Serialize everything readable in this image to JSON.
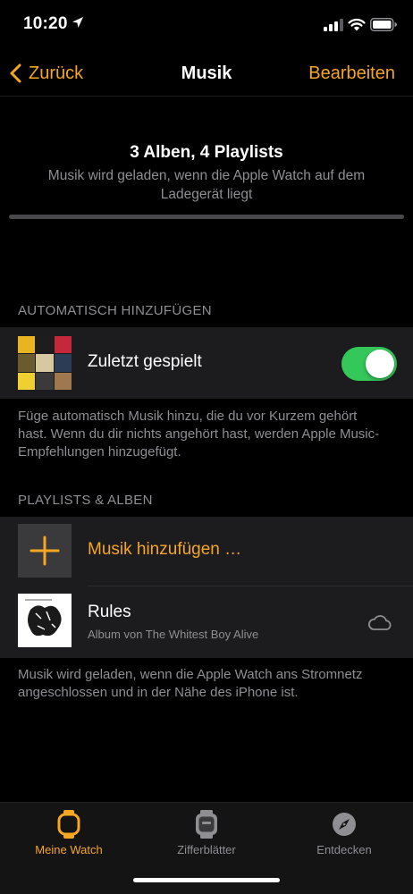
{
  "status": {
    "time": "10:20"
  },
  "nav": {
    "back_label": "Zurück",
    "title": "Musik",
    "edit_label": "Bearbeiten"
  },
  "sync": {
    "title": "3 Alben, 4 Playlists",
    "subtitle": "Musik wird geladen, wenn die Apple Watch auf dem Ladegerät liegt",
    "progress": 0.0
  },
  "auto_section": {
    "header": "AUTOMATISCH HINZUFÜGEN",
    "row_label": "Zuletzt gespielt",
    "toggle_on": true,
    "footer": "Füge automatisch Musik hinzu, die du vor Kurzem gehört hast. Wenn du dir nichts angehört hast, werden Apple Music-Empfehlungen hinzugefügt."
  },
  "playlists_section": {
    "header": "PLAYLISTS & ALBEN",
    "add_label": "Musik hinzufügen …",
    "albums": [
      {
        "title": "Rules",
        "subtitle": "Album von The Whitest Boy Alive",
        "status_icon": "cloud-icon"
      }
    ],
    "footer": "Musik wird geladen, wenn die Apple Watch ans Stromnetz angeschlossen und in der Nähe des iPhone ist."
  },
  "tabs": [
    {
      "label": "Meine Watch",
      "icon": "watch-icon",
      "active": true
    },
    {
      "label": "Zifferblätter",
      "icon": "watch-face-icon",
      "active": false
    },
    {
      "label": "Entdecken",
      "icon": "compass-icon",
      "active": false
    }
  ],
  "colors": {
    "accent": "#f5a623",
    "toggle_on": "#34c759",
    "row_bg": "#1c1c1e",
    "secondary_text": "#8e8e93"
  }
}
